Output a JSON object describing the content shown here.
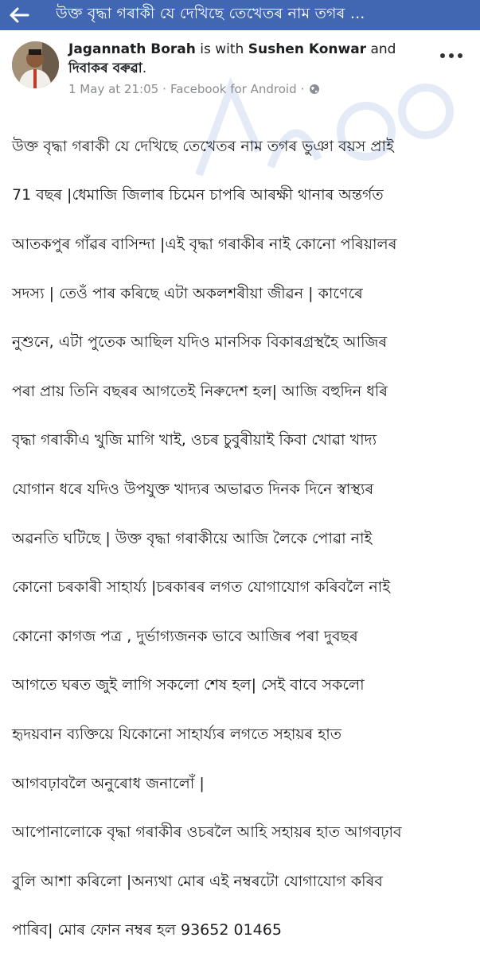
{
  "topbar": {
    "title": "উক্ত বৃদ্ধা গৰাকী যে দেখিছে তেখেতৰ নাম তগৰ ...",
    "back_icon": "arrow-left-icon",
    "bg_color": "#4267b2"
  },
  "post": {
    "author": "Jagannath Borah",
    "with_text": "is with",
    "tagged_1": "Sushen Konwar",
    "and_text": "and",
    "tagged_2": "দিবাকৰ বৰুৱা",
    "period": ".",
    "timestamp": "1 May at 21:05",
    "separator": "·",
    "source": "Facebook for Android",
    "separator_2": "·",
    "privacy_icon": "globe-icon",
    "more_icon": "more-dots-icon",
    "body_lines": [
      "উক্ত বৃদ্ধা গৰাকী যে দেখিছে তেখেতৰ নাম তগৰ ভুঞা বয়স প্ৰাই",
      "71 বছৰ |ধেমাজি জিলাৰ চিমেন চাপৰি আৰক্ষী থানাৰ অন্তৰ্গত",
      "আতকপুৰ গাঁৱৰ বাসিন্দা |এই বৃদ্ধা গৰাকীৰ নাই কোনো পৰিয়ালৰ",
      "সদস্য | তেওঁ পাৰ কৰিছে এটা অকলশৰীয়া জীৱন | কাণেৰে",
      "নুশুনে, এটা পুতেক আছিল যদিও মানসিক বিকাৰগ্ৰস্থহৈ আজিৰ",
      "পৰা প্ৰায় তিনি বছৰৰ আগতেই নিৰুদেশ হল| আজি বহুদিন ধৰি",
      "বৃদ্ধা গৰাকীএ খুজি মাগি খাই, ওচৰ চুবুৰীয়াই কিবা খোৱা খাদ্য",
      "যোগান ধৰে যদিও উপযুক্ত খাদ্যৰ অভাৱত দিনক দিনে স্বাস্থ্যৰ",
      "অৱনতি ঘটিছে | উক্ত বৃদ্ধা গৰাকীয়ে আজি লৈকে পোৱা নাই",
      "কোনো চৰকাৰী সাহাৰ্য্য |চৰকাৰৰ লগত যোগাযোগ কৰিবলৈ নাই",
      "কোনো কাগজ পত্ৰ , দুৰ্ভাগ্যজনক ভাবে আজিৰ পৰা দুবছৰ",
      "আগতে ঘৰত জুই লাগি সকলো শেষ হল| সেই বাবে সকলো",
      "হৃদয়বান ব্যক্তিয়ে যিকোনো সাহাৰ্য্যৰ লগতে সহায়ৰ হাত",
      "আগবঢ়াবলৈ অনুৰোধ জনালোঁ |",
      "আপোনালোকে বৃদ্ধা গৰাকীৰ ওচৰলৈ আহি সহায়ৰ হাত আগবঢ়াব",
      "বুলি আশা কৰিলো |অন্যথা মোৰ এই নম্বৰটো যোগাযোগ কৰিব",
      "পাৰিব| মোৰ ফোন নম্বৰ হল 93652 01465"
    ]
  }
}
